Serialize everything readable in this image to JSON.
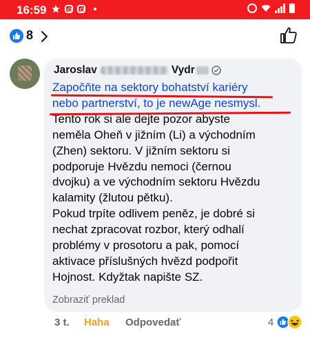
{
  "status_bar": {
    "time": "16:59",
    "colors": {
      "background": "#f21b1f"
    }
  },
  "header": {
    "like_count": "8",
    "icons": [
      "like-badge-icon",
      "chevron-right-icon",
      "thumbs-up-outline-icon"
    ]
  },
  "comment": {
    "author_first": "Jaroslav",
    "author_last": "Vydr",
    "highlight_lines": [
      "Započňte na sektory bohatství kariéry",
      "nebo partnerství, to je newAge nesmysl."
    ],
    "body_lines": [
      "Tento rok si ale dejte pozor abyste",
      "neměla Oheň v jižním (Li) a východním",
      "(Zhen) sektoru. V jižním sektoru si",
      "podporuje Hvězdu nemoci (černou",
      "dvojku) a ve východním sektoru Hvězdu",
      "kalamity (žlutou pětku).",
      "Pokud trpíte odlivem peněz, je dobré si",
      "nechat zpracovat rozbor, který odhalí",
      "problémy v prosotoru a pak, pomocí",
      "aktivace příslušných hvězd podpořit",
      "Hojnost.  Kdyžtak napište SZ."
    ],
    "translate_link": "Zobraziť preklad"
  },
  "actions": {
    "time_ago": "3 t.",
    "reaction_label": "Haha",
    "reply_label": "Odpovedať",
    "reaction_count": "4"
  },
  "colors": {
    "like_blue": "#1877f2",
    "haha_yellow": "#e7a41c",
    "highlight_text": "#1246c9",
    "underline_red": "#e0161d",
    "bubble": "#f0f2f5"
  }
}
